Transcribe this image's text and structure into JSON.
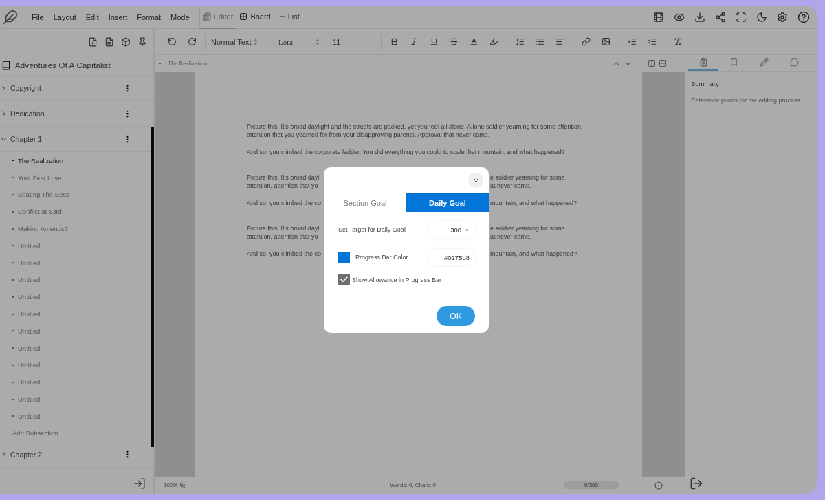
{
  "menu": {
    "items": [
      "File",
      "Layout",
      "Edit",
      "Insert",
      "Format",
      "Mode"
    ]
  },
  "view_tabs": [
    {
      "label": "Editor",
      "kind": "editor",
      "selected": true
    },
    {
      "label": "Board",
      "kind": "board",
      "selected": false
    },
    {
      "label": "List",
      "kind": "list",
      "selected": false
    }
  ],
  "sidebar": {
    "book_title": "Adventures Of A Capitalist",
    "items": [
      {
        "label": "Copyright",
        "expanded": false
      },
      {
        "label": "Dedication",
        "expanded": false
      },
      {
        "label": "Chapter 1",
        "expanded": true,
        "add_label": "Add Subsection",
        "children": [
          {
            "label": "The Realization",
            "selected": true
          },
          {
            "label": "Your First Love",
            "selected": false
          },
          {
            "label": "Beating The Boss",
            "selected": false
          },
          {
            "label": "Conflict at 63rd",
            "selected": false
          },
          {
            "label": "Making Amends?",
            "selected": false
          },
          {
            "label": "Untitled",
            "selected": false
          },
          {
            "label": "Untitled",
            "selected": false
          },
          {
            "label": "Untitled",
            "selected": false
          },
          {
            "label": "Untitled",
            "selected": false
          },
          {
            "label": "Untitled",
            "selected": false
          },
          {
            "label": "Untitled",
            "selected": false
          },
          {
            "label": "Untitled",
            "selected": false
          },
          {
            "label": "Untitled",
            "selected": false
          },
          {
            "label": "Untitled",
            "selected": false
          },
          {
            "label": "Untitled",
            "selected": false
          },
          {
            "label": "Untitled",
            "selected": false
          }
        ]
      },
      {
        "label": "Chapter 2",
        "expanded": false
      }
    ]
  },
  "toolbar": {
    "style_select": "Normal Text",
    "font_select": "Lora",
    "font_size": "11"
  },
  "breadcrumb": "The Realization",
  "document": {
    "paragraphs": [
      {
        "kind": "full",
        "text": "Picture this. It's broad daylight and the streets are packed, yet you feel all alone. A lone soldier yearning for some attention, attention that you yearned for from your disapproving parents. Approval that never came."
      },
      {
        "kind": "full",
        "text": "And so, you climbed the corporate ladder. You did everything you could to scale that mountain, and what happened?"
      },
      {
        "kind": "split",
        "lines": [
          {
            "left": "Picture this. It's broad dayl",
            "right": "e soldier yearning for some"
          },
          {
            "left": "attention, attention that yo",
            "right": "at never came."
          }
        ]
      },
      {
        "kind": "split",
        "lines": [
          {
            "left": "And so, you climbed the co",
            "right": "mountain, and what happened?"
          }
        ]
      },
      {
        "kind": "split",
        "lines": [
          {
            "left": "Picture this. It's broad dayl",
            "right": "e soldier yearning for some"
          },
          {
            "left": "attention, attention that yo",
            "right": "at never came."
          }
        ]
      },
      {
        "kind": "split",
        "lines": [
          {
            "left": "And so, you climbed the co",
            "right": "mountain, and what happened?"
          }
        ]
      }
    ]
  },
  "status_bar": {
    "zoom": "100%",
    "counts": "Words: 0, Chars: 0",
    "progress": {
      "label": "0/300",
      "level": 0
    }
  },
  "right_panel": {
    "tabs": [
      {
        "kind": "summary",
        "selected": true
      },
      {
        "kind": "bookmark",
        "selected": false
      },
      {
        "kind": "notes",
        "selected": false
      },
      {
        "kind": "comments",
        "selected": false
      }
    ],
    "heading": "Summary",
    "field": {
      "placeholder": "Reference points for the editing process"
    }
  },
  "dialog": {
    "tabs": [
      {
        "label": "Section Goal",
        "selected": false
      },
      {
        "label": "Daily Goal",
        "selected": true
      }
    ],
    "target": {
      "label": "Set Target for Daily Goal",
      "value": "300"
    },
    "color": {
      "label": "Progress Bar Color",
      "value": "#0275d8"
    },
    "allowance": {
      "label": "Show Allowance in Progress Bar",
      "checked": true
    },
    "ok": "OK"
  }
}
